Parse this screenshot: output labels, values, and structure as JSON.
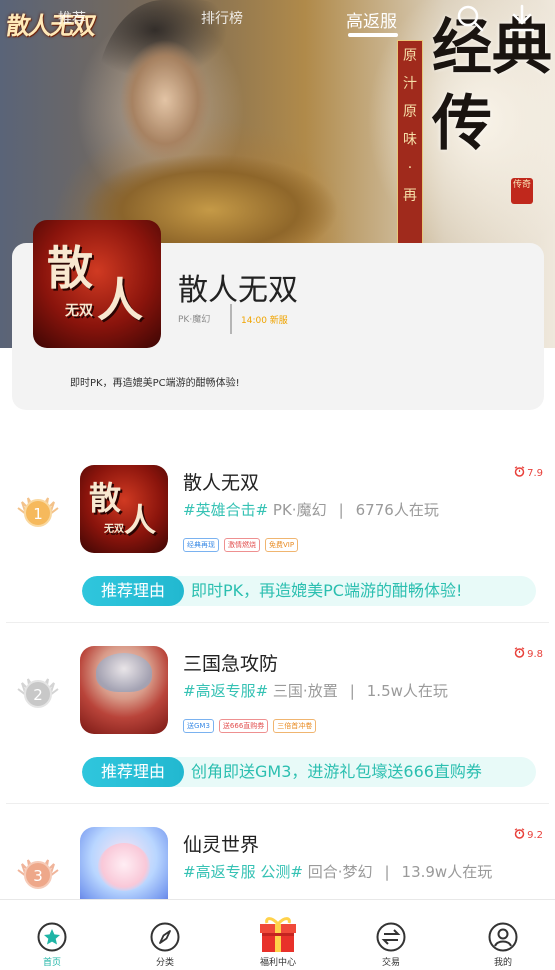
{
  "hero": {
    "logo_text": "散人无双",
    "tabs": {
      "recommend": "推荐",
      "ranking": "排行榜",
      "high_rebate": "高返服"
    },
    "slogan_vertical": [
      "原",
      "汁",
      "原",
      "味",
      "·",
      "再"
    ],
    "big_title": "经典传",
    "seal_text": "传奇"
  },
  "featured": {
    "name": "散人无双",
    "icon_text": [
      "散",
      "人",
      "无双"
    ],
    "tags": "PK·魔幻",
    "server_time": "14:00 新服",
    "description": "即时PK，再造媲美PC端游的酣畅体验!"
  },
  "games": [
    {
      "rank": "1",
      "name": "散人无双",
      "rating": "7.9",
      "hashtag": "#英雄合击#",
      "genre": "PK·魔幻",
      "players": "6776人在玩",
      "chips": [
        {
          "text": "经典再现",
          "color": "blue"
        },
        {
          "text": "激情燃烧",
          "color": "red"
        },
        {
          "text": "免费VIP",
          "color": "orange"
        }
      ],
      "reason_label": "推荐理由",
      "reason": "即时PK，再造媲美PC端游的酣畅体验!"
    },
    {
      "rank": "2",
      "name": "三国急攻防",
      "rating": "9.8",
      "hashtag": "#高返专服#",
      "genre": "三国·放置",
      "players": "1.5w人在玩",
      "chips": [
        {
          "text": "送GM3",
          "color": "blue"
        },
        {
          "text": "送666直购券",
          "color": "red"
        },
        {
          "text": "三倍首冲卷",
          "color": "orange"
        }
      ],
      "reason_label": "推荐理由",
      "reason": "创角即送GM3，进游礼包壕送666直购券"
    },
    {
      "rank": "3",
      "name": "仙灵世界",
      "rating": "9.2",
      "hashtag": "#高返专服 公测#",
      "genre": "回合·梦幻",
      "players": "13.9w人在玩"
    }
  ],
  "bottom_nav": [
    {
      "label": "首页",
      "icon": "star-icon",
      "active": true
    },
    {
      "label": "分类",
      "icon": "compass-icon",
      "active": false
    },
    {
      "label": "福利中心",
      "icon": "gift-icon",
      "active": false
    },
    {
      "label": "交易",
      "icon": "exchange-icon",
      "active": false
    },
    {
      "label": "我的",
      "icon": "user-icon",
      "active": false
    }
  ],
  "colors": {
    "accent": "#1fb5a6",
    "hashtag": "#36c2b4",
    "rating": "#e8413b",
    "server_time": "#f0a400"
  }
}
